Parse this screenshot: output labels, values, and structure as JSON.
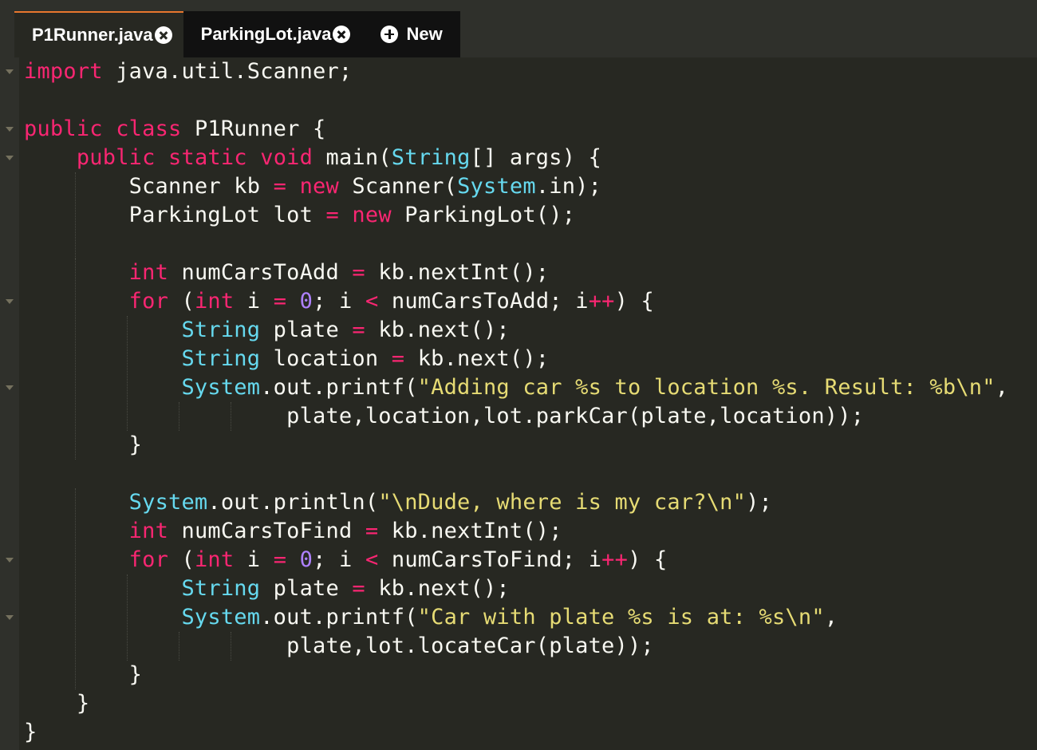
{
  "tabs": [
    {
      "label": "P1Runner.java",
      "active": true
    },
    {
      "label": "ParkingLot.java",
      "active": false
    }
  ],
  "new_tab": {
    "label": "New"
  },
  "colors": {
    "background": "#272822",
    "keyword": "#f92672",
    "type": "#66d9ef",
    "string": "#e6db74",
    "number": "#ae81ff",
    "plain": "#f8f8f2",
    "tab_accent": "#e8772e"
  },
  "code": {
    "lines": [
      [
        [
          "kw",
          "import"
        ],
        [
          "pl",
          " java.util.Scanner;"
        ]
      ],
      [],
      [
        [
          "kw",
          "public"
        ],
        [
          "pl",
          " "
        ],
        [
          "kw",
          "class"
        ],
        [
          "pl",
          " P1Runner {"
        ]
      ],
      [
        [
          "pl",
          "    "
        ],
        [
          "kw",
          "public"
        ],
        [
          "pl",
          " "
        ],
        [
          "kw",
          "static"
        ],
        [
          "pl",
          " "
        ],
        [
          "kw",
          "void"
        ],
        [
          "pl",
          " main("
        ],
        [
          "ty",
          "String"
        ],
        [
          "pl",
          "[] args) {"
        ]
      ],
      [
        [
          "pl",
          "        Scanner kb "
        ],
        [
          "kw",
          "="
        ],
        [
          "pl",
          " "
        ],
        [
          "kw",
          "new"
        ],
        [
          "pl",
          " Scanner("
        ],
        [
          "ty",
          "System"
        ],
        [
          "pl",
          ".in);"
        ]
      ],
      [
        [
          "pl",
          "        ParkingLot lot "
        ],
        [
          "kw",
          "="
        ],
        [
          "pl",
          " "
        ],
        [
          "kw",
          "new"
        ],
        [
          "pl",
          " ParkingLot();"
        ]
      ],
      [],
      [
        [
          "pl",
          "        "
        ],
        [
          "kw",
          "int"
        ],
        [
          "pl",
          " numCarsToAdd "
        ],
        [
          "kw",
          "="
        ],
        [
          "pl",
          " kb.nextInt();"
        ]
      ],
      [
        [
          "pl",
          "        "
        ],
        [
          "kw",
          "for"
        ],
        [
          "pl",
          " ("
        ],
        [
          "kw",
          "int"
        ],
        [
          "pl",
          " i "
        ],
        [
          "kw",
          "="
        ],
        [
          "pl",
          " "
        ],
        [
          "nu",
          "0"
        ],
        [
          "pl",
          "; i "
        ],
        [
          "kw",
          "<"
        ],
        [
          "pl",
          " numCarsToAdd; i"
        ],
        [
          "kw",
          "++"
        ],
        [
          "pl",
          ") {"
        ]
      ],
      [
        [
          "pl",
          "            "
        ],
        [
          "ty",
          "String"
        ],
        [
          "pl",
          " plate "
        ],
        [
          "kw",
          "="
        ],
        [
          "pl",
          " kb.next();"
        ]
      ],
      [
        [
          "pl",
          "            "
        ],
        [
          "ty",
          "String"
        ],
        [
          "pl",
          " location "
        ],
        [
          "kw",
          "="
        ],
        [
          "pl",
          " kb.next();"
        ]
      ],
      [
        [
          "pl",
          "            "
        ],
        [
          "ty",
          "System"
        ],
        [
          "pl",
          ".out.printf("
        ],
        [
          "st",
          "\"Adding car %s to location %s. Result: %b\\n\""
        ],
        [
          "pl",
          ","
        ]
      ],
      [
        [
          "pl",
          "                    plate,location,lot.parkCar(plate,location));"
        ]
      ],
      [
        [
          "pl",
          "        }"
        ]
      ],
      [],
      [
        [
          "pl",
          "        "
        ],
        [
          "ty",
          "System"
        ],
        [
          "pl",
          ".out.println("
        ],
        [
          "st",
          "\"\\nDude, where is my car?\\n\""
        ],
        [
          "pl",
          ");"
        ]
      ],
      [
        [
          "pl",
          "        "
        ],
        [
          "kw",
          "int"
        ],
        [
          "pl",
          " numCarsToFind "
        ],
        [
          "kw",
          "="
        ],
        [
          "pl",
          " kb.nextInt();"
        ]
      ],
      [
        [
          "pl",
          "        "
        ],
        [
          "kw",
          "for"
        ],
        [
          "pl",
          " ("
        ],
        [
          "kw",
          "int"
        ],
        [
          "pl",
          " i "
        ],
        [
          "kw",
          "="
        ],
        [
          "pl",
          " "
        ],
        [
          "nu",
          "0"
        ],
        [
          "pl",
          "; i "
        ],
        [
          "kw",
          "<"
        ],
        [
          "pl",
          " numCarsToFind; i"
        ],
        [
          "kw",
          "++"
        ],
        [
          "pl",
          ") {"
        ]
      ],
      [
        [
          "pl",
          "            "
        ],
        [
          "ty",
          "String"
        ],
        [
          "pl",
          " plate "
        ],
        [
          "kw",
          "="
        ],
        [
          "pl",
          " kb.next();"
        ]
      ],
      [
        [
          "pl",
          "            "
        ],
        [
          "ty",
          "System"
        ],
        [
          "pl",
          ".out.printf("
        ],
        [
          "st",
          "\"Car with plate %s is at: %s\\n\""
        ],
        [
          "pl",
          ","
        ]
      ],
      [
        [
          "pl",
          "                    plate,lot.locateCar(plate));"
        ]
      ],
      [
        [
          "pl",
          "        }"
        ]
      ],
      [
        [
          "pl",
          "    }"
        ]
      ],
      [
        [
          "pl",
          "}"
        ]
      ]
    ],
    "fold_lines": [
      0,
      2,
      3,
      8,
      11,
      17,
      19
    ]
  }
}
